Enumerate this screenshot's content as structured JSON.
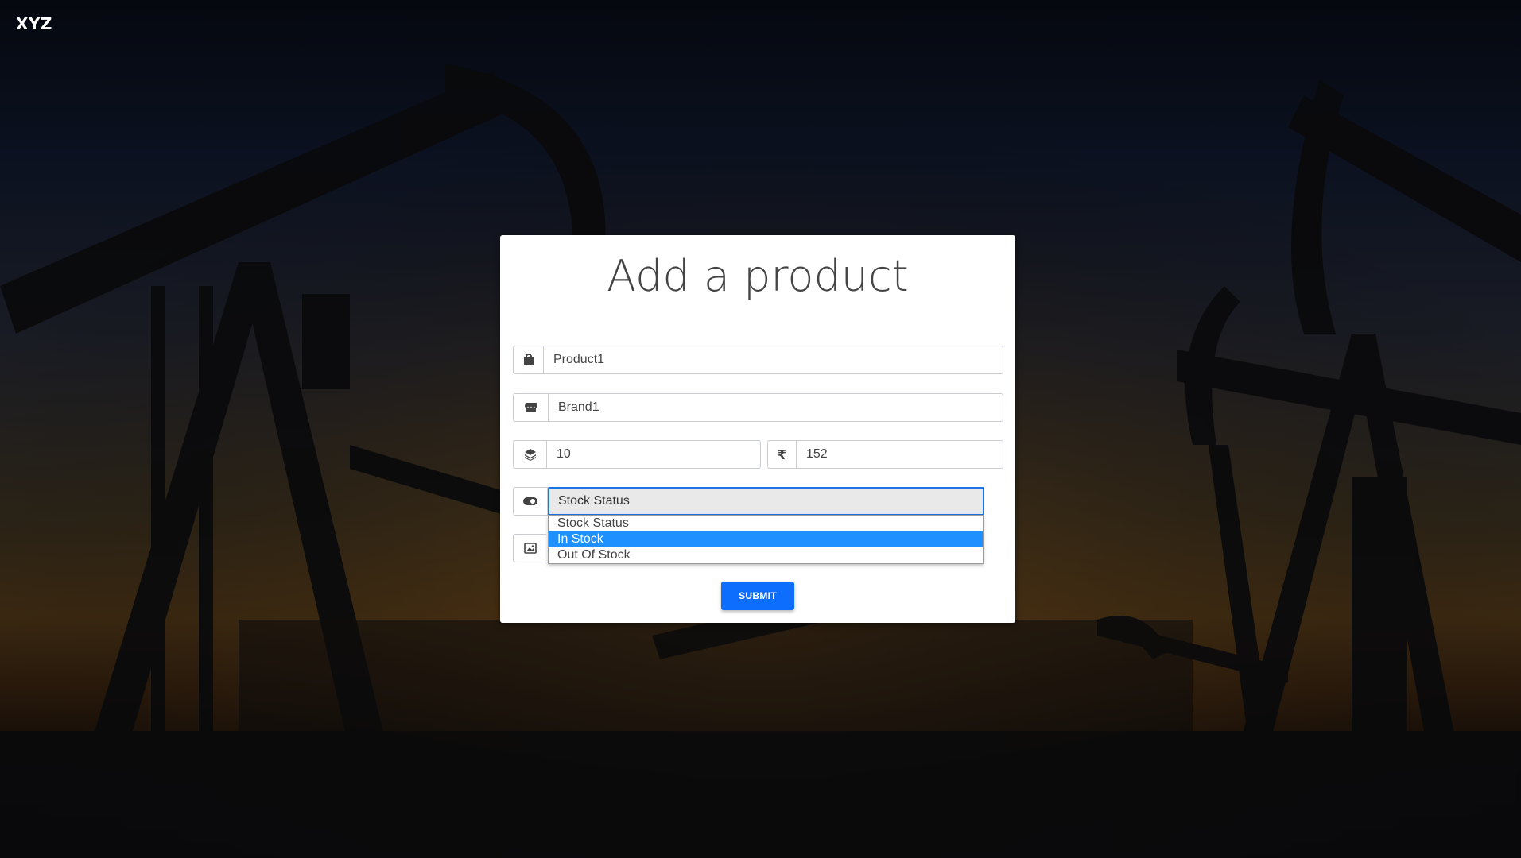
{
  "header": {
    "brand": "XYZ"
  },
  "form": {
    "title": "Add a product",
    "product_name": {
      "value": "Product1",
      "icon": "shopping-bag-icon"
    },
    "brand_name": {
      "value": "Brand1",
      "icon": "store-icon"
    },
    "quantity": {
      "value": "10",
      "icon": "layers-icon"
    },
    "price": {
      "value": "152",
      "icon": "rupee-icon",
      "currency_symbol": "₹"
    },
    "stock_status": {
      "icon": "toggle-icon",
      "selected": "Stock Status",
      "options": [
        "Stock Status",
        "In Stock",
        "Out Of Stock"
      ],
      "highlighted_index": 1
    },
    "image": {
      "icon": "image-icon"
    },
    "submit_label": "SUBMIT"
  },
  "colors": {
    "primary": "#0d6efd",
    "highlight": "#1e90ff",
    "focus_border": "#1a73e8"
  }
}
